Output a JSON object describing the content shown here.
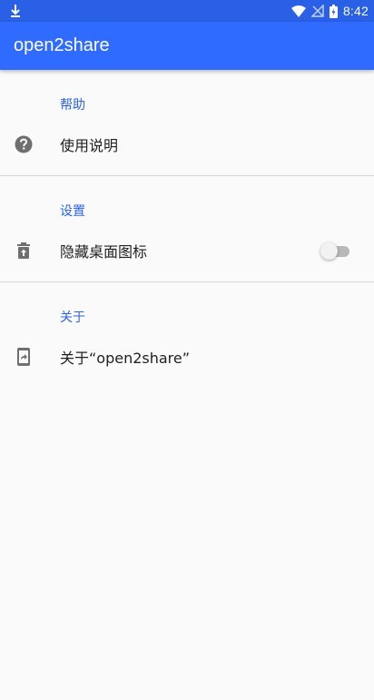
{
  "status_bar": {
    "time": "8:42",
    "icons": [
      "download-icon",
      "wifi-icon",
      "signal-off-icon",
      "battery-icon"
    ]
  },
  "app_bar": {
    "title": "open2share"
  },
  "sections": {
    "help": {
      "header": "帮助",
      "item_label": "使用说明",
      "item_icon": "help-circle-icon"
    },
    "settings": {
      "header": "设置",
      "item_label": "隐藏桌面图标",
      "item_icon": "delete-restore-icon",
      "toggle_on": false
    },
    "about": {
      "header": "关于",
      "item_label": "关于“open2share”",
      "item_icon": "phone-share-icon"
    }
  },
  "colors": {
    "status_bar": "#2a60e6",
    "app_bar": "#2f6bff",
    "accent": "#2a63e8",
    "background": "#fafafa",
    "icon": "#6f6f6f"
  }
}
